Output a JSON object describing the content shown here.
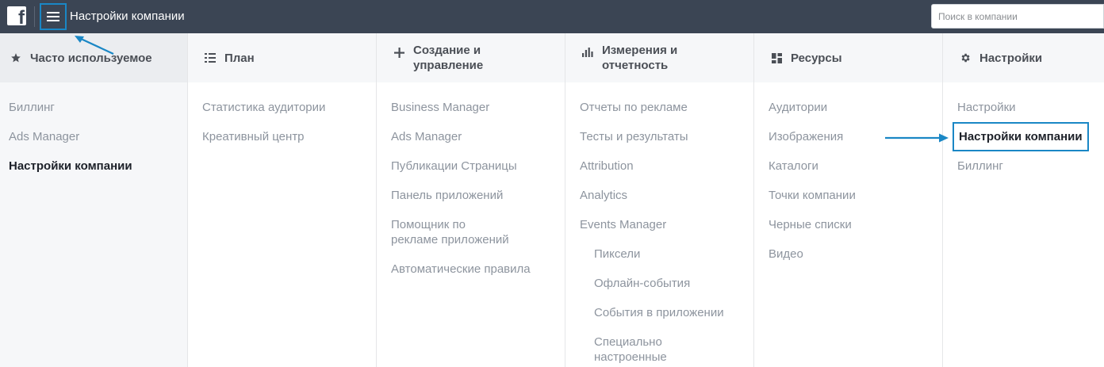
{
  "topbar": {
    "title": "Настройки компании",
    "search_placeholder": "Поиск в компании",
    "accent": "#1a87c5",
    "background": "#3b4554"
  },
  "columns": [
    {
      "title": "Часто используемое",
      "icon": "star-icon",
      "items": [
        {
          "label": "Биллинг"
        },
        {
          "label": "Ads Manager"
        },
        {
          "label": "Настройки компании",
          "active": true
        }
      ]
    },
    {
      "title": "План",
      "icon": "list-icon",
      "items": [
        {
          "label": "Статистика аудитории"
        },
        {
          "label": "Креативный центр"
        }
      ]
    },
    {
      "title": "Создание и управление",
      "icon": "plus-icon",
      "items": [
        {
          "label": "Business Manager"
        },
        {
          "label": "Ads Manager"
        },
        {
          "label": "Публикации Страницы"
        },
        {
          "label": "Панель приложений"
        },
        {
          "label": "Помощник по рекламе приложений"
        },
        {
          "label": "Автоматические правила"
        }
      ]
    },
    {
      "title": "Измерения и отчетность",
      "icon": "bar-chart-icon",
      "items": [
        {
          "label": "Отчеты по рекламе"
        },
        {
          "label": "Тесты и результаты"
        },
        {
          "label": "Attribution"
        },
        {
          "label": "Analytics"
        },
        {
          "label": "Events Manager"
        },
        {
          "label": "Пиксели",
          "sub": true
        },
        {
          "label": "Офлайн-события",
          "sub": true
        },
        {
          "label": "События в приложении",
          "sub": true
        },
        {
          "label": "Специально настроенные конверсии",
          "sub": true
        }
      ]
    },
    {
      "title": "Ресурсы",
      "icon": "grid-icon",
      "items": [
        {
          "label": "Аудитории"
        },
        {
          "label": "Изображения"
        },
        {
          "label": "Каталоги"
        },
        {
          "label": "Точки компании"
        },
        {
          "label": "Черные списки"
        },
        {
          "label": "Видео"
        }
      ]
    },
    {
      "title": "Настройки",
      "icon": "gear-icon",
      "items": [
        {
          "label": "Настройки"
        },
        {
          "label": "Настройки компании",
          "highlighted": true
        },
        {
          "label": "Биллинг"
        }
      ]
    }
  ]
}
